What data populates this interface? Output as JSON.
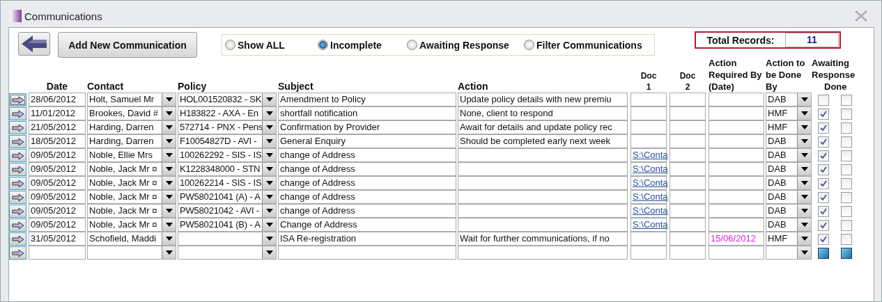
{
  "window": {
    "title": "Communications"
  },
  "toolbar": {
    "add_button": "Add New Communication"
  },
  "filters": [
    {
      "label": "Show ALL",
      "selected": false
    },
    {
      "label": "Incomplete",
      "selected": true
    },
    {
      "label": "Awaiting Response",
      "selected": false
    },
    {
      "label": "Filter Communications",
      "selected": false
    }
  ],
  "total": {
    "label": "Total Records:",
    "value": "11"
  },
  "columns": {
    "date": "Date",
    "contact": "Contact",
    "policy": "Policy",
    "subject": "Subject",
    "action": "Action",
    "doc1": [
      "Doc",
      "1"
    ],
    "doc2": [
      "Doc",
      "2"
    ],
    "required_by": [
      "Action",
      "Required By",
      "(Date)"
    ],
    "done_by": [
      "Action to",
      "be Done",
      "By"
    ],
    "awaiting": [
      "Awaiting",
      "Response"
    ],
    "done": "Done"
  },
  "rows": [
    {
      "selected": true,
      "date": "28/06/2012",
      "contact": "Holt, Samuel Mr",
      "policy": "HOL001520832 - SK",
      "subject": "Amendment to Policy",
      "action": "Update policy details with new premiu",
      "doc1": "",
      "required_by": "",
      "done_by": "DAB",
      "awaiting": false,
      "done": false
    },
    {
      "selected": false,
      "date": "11/01/2012",
      "contact": "Brookes, David #",
      "policy": "H183822 - AXA - En",
      "subject": "shortfall notification",
      "action": "None, client to respond",
      "doc1": "",
      "required_by": "",
      "done_by": "HMF",
      "awaiting": true,
      "done": false
    },
    {
      "selected": false,
      "date": "21/05/2012",
      "contact": "Harding, Darren",
      "policy": "572714 - PNX - Pens",
      "subject": "Confirmation by Provider",
      "action": "Await for details and update policy rec",
      "doc1": "",
      "required_by": "",
      "done_by": "HMF",
      "awaiting": true,
      "done": false
    },
    {
      "selected": false,
      "date": "18/05/2012",
      "contact": "Harding, Darren",
      "policy": "F10054827D - AVI -",
      "subject": "General Enquiry",
      "action": "Should be completed early next week",
      "doc1": "",
      "required_by": "",
      "done_by": "DAB",
      "awaiting": true,
      "done": false
    },
    {
      "selected": false,
      "date": "09/05/2012",
      "contact": "Noble, Ellie Mrs",
      "policy": "100262292 - SIS - IS",
      "subject": "change of Address",
      "action": "",
      "doc1": "S:\\Conta",
      "required_by": "",
      "done_by": "DAB",
      "awaiting": true,
      "done": false
    },
    {
      "selected": false,
      "date": "09/05/2012",
      "contact": "Noble, Jack Mr ¤",
      "policy": "K1228348000 - STN",
      "subject": "change of Address",
      "action": "",
      "doc1": "S:\\Conta",
      "required_by": "",
      "done_by": "DAB",
      "awaiting": true,
      "done": false
    },
    {
      "selected": false,
      "date": "09/05/2012",
      "contact": "Noble, Jack Mr ¤",
      "policy": "100262214 - SIS - IS",
      "subject": "change of Address",
      "action": "",
      "doc1": "S:\\Conta",
      "required_by": "",
      "done_by": "DAB",
      "awaiting": true,
      "done": false
    },
    {
      "selected": false,
      "date": "09/05/2012",
      "contact": "Noble, Jack Mr ¤",
      "policy": "PW58021041 (A) - A",
      "subject": "change of Address",
      "action": "",
      "doc1": "S:\\Conta",
      "required_by": "",
      "done_by": "DAB",
      "awaiting": true,
      "done": false
    },
    {
      "selected": false,
      "date": "09/05/2012",
      "contact": "Noble, Jack Mr ¤",
      "policy": "PW58021042 - AVI -",
      "subject": "change of Address",
      "action": "",
      "doc1": "S:\\Conta",
      "required_by": "",
      "done_by": "DAB",
      "awaiting": true,
      "done": false
    },
    {
      "selected": false,
      "date": "09/05/2012",
      "contact": "Noble, Jack Mr ¤",
      "policy": "PW58021041 (B) - A",
      "subject": "Change of Address",
      "action": "",
      "doc1": "S:\\Conta",
      "required_by": "",
      "done_by": "DAB",
      "awaiting": true,
      "done": false
    },
    {
      "selected": false,
      "date": "31/05/2012",
      "contact": "Schofield, Maddi",
      "policy": "",
      "subject": "ISA Re-registration",
      "action": "Wait for further communications, if no",
      "doc1": "",
      "required_by": "15/06/2012",
      "done_by": "HMF",
      "awaiting": true,
      "done": false
    },
    {
      "selected": false,
      "date": "",
      "contact": "",
      "policy": "",
      "subject": "",
      "action": "",
      "doc1": "",
      "required_by": "",
      "done_by": "",
      "awaiting": null,
      "done": null
    }
  ]
}
